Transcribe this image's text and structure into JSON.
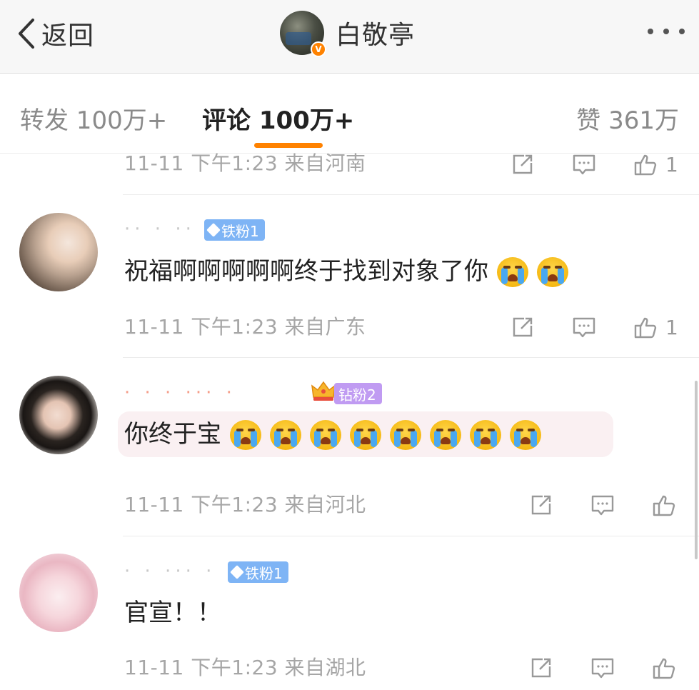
{
  "header": {
    "back_label": "返回",
    "title": "白敬亭",
    "verified_badge": "V",
    "more_icon": "more-dots-icon"
  },
  "tabs": {
    "forward": "转发 100万+",
    "comment": "评论 100万+",
    "like": "赞 361万",
    "active_color": "#ff8200"
  },
  "comments": [
    {
      "content": "",
      "meta": "11-11 下午1:23 来自河南",
      "like_count": "1"
    },
    {
      "username": "·· ·  ··",
      "fan_badge": "铁粉1",
      "content": "祝福啊啊啊啊啊终于找到对象了你",
      "emoji_count": 2,
      "meta": "11-11 下午1:23 来自广东",
      "like_count": "1"
    },
    {
      "username": "·  ·  ·  ···  ·",
      "fan_badge": "钻粉2",
      "content": "你终于宝",
      "emoji_count": 8,
      "meta": "11-11 下午1:23 来自河北",
      "like_count": ""
    },
    {
      "username": "· · ···  ·",
      "fan_badge": "铁粉1",
      "content": "官宣！！",
      "emoji_count": 0,
      "meta": "11-11 下午1:23 来自湖北",
      "like_count": ""
    }
  ],
  "colors": {
    "iron_badge": "#7eb4f5",
    "diamond_badge": "#c09bf2",
    "meta_text": "#a6a6a6"
  }
}
